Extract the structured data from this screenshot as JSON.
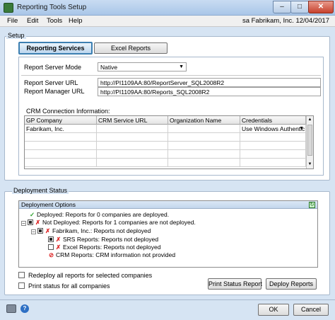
{
  "window": {
    "title": "Reporting Tools Setup"
  },
  "menu": {
    "items": [
      "File",
      "Edit",
      "Tools",
      "Help"
    ],
    "status": "sa  Fabrikam, Inc.  12/04/2017"
  },
  "setup": {
    "group_title": "Setup",
    "tabs": [
      {
        "label": "Reporting Services",
        "selected": true
      },
      {
        "label": "Excel Reports",
        "selected": false
      }
    ],
    "report_server_mode": {
      "label": "Report Server Mode",
      "value": "Native"
    },
    "report_server_url": {
      "label": "Report Server URL",
      "value": "http://PI1109AA:80/ReportServer_SQL2008R2"
    },
    "report_manager_url": {
      "label": "Report Manager URL",
      "value": "http://PI1109AA:80/Reports_SQL2008R2"
    },
    "crm": {
      "label": "CRM Connection Information:",
      "columns": [
        "GP Company",
        "CRM Service URL",
        "Organization Name",
        "Credentials"
      ],
      "rows": [
        [
          "Fabrikam, Inc.",
          "",
          "",
          "Use Windows Authentic"
        ]
      ]
    }
  },
  "deployment": {
    "group_title": "Deployment Status",
    "tree_header": "Deployment Options",
    "nodes": [
      "Deployed: Reports for 0 companies are deployed.",
      "Not Deployed: Reports for 1 companies are not deployed.",
      "Fabrikam, Inc.: Reports not deployed",
      "SRS Reports: Reports not deployed",
      "Excel Reports: Reports not deployed",
      "CRM Reports: CRM information not provided"
    ],
    "options": {
      "redeploy": "Redeploy all reports for selected companies",
      "print_status_all": "Print status for all companies"
    },
    "buttons": {
      "print_status": "Print Status Report",
      "deploy": "Deploy Reports"
    }
  },
  "footer": {
    "ok": "OK",
    "cancel": "Cancel"
  },
  "colors": {
    "accent": "#3c7fb1",
    "ok_green": "#2aa02a",
    "error_red": "#d22222"
  }
}
